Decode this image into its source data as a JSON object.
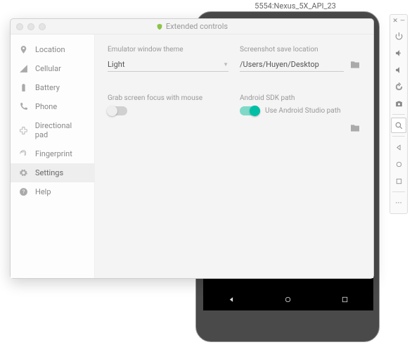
{
  "emulator": {
    "title": "5554:Nexus_5X_API_23"
  },
  "extended": {
    "title": "Extended controls",
    "sidebar": {
      "items": [
        {
          "label": "Location"
        },
        {
          "label": "Cellular"
        },
        {
          "label": "Battery"
        },
        {
          "label": "Phone"
        },
        {
          "label": "Directional pad"
        },
        {
          "label": "Fingerprint"
        },
        {
          "label": "Settings"
        },
        {
          "label": "Help"
        }
      ],
      "selected": "Settings"
    },
    "settings": {
      "theme_label": "Emulator window theme",
      "theme_value": "Light",
      "grab_focus_label": "Grab screen focus with mouse",
      "grab_focus_on": false,
      "screenshot_label": "Screenshot save location",
      "screenshot_path": "/Users/Huyen/Desktop",
      "sdk_label": "Android SDK path",
      "use_studio_label": "Use Android Studio path",
      "use_studio_on": true
    }
  },
  "colors": {
    "accent": "#00bfa5"
  }
}
